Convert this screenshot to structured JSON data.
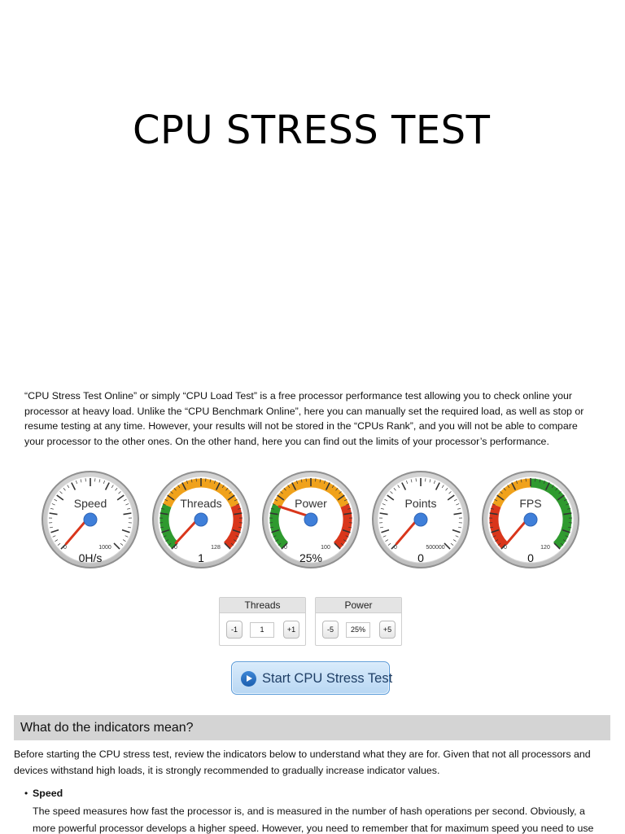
{
  "title": "CPU STRESS TEST",
  "intro": "“CPU Stress Test Online” or simply “CPU Load Test” is a free processor performance test allowing you to check online your processor at heavy load. Unlike the “CPU Benchmark Online”, here you can manually set the required load, as well as stop or resume testing at any time. However, your results will not be stored in the “CPUs Rank”, and you will not be able to compare your processor to the other ones. On the other hand, here you can find out the limits of your processor’s performance.",
  "gauges": [
    {
      "label": "Speed",
      "min": "0",
      "max": "1000",
      "value_text": "0H/s",
      "value": 0,
      "range_max": 1000,
      "bands": []
    },
    {
      "label": "Threads",
      "min": "0",
      "max": "128",
      "value_text": "1",
      "value": 1,
      "range_max": 128,
      "bands": [
        {
          "from": 0.0,
          "to": 0.25,
          "color": "#2f9a2f"
        },
        {
          "from": 0.25,
          "to": 0.75,
          "color": "#f0a21b"
        },
        {
          "from": 0.75,
          "to": 1.0,
          "color": "#d9361b"
        }
      ]
    },
    {
      "label": "Power",
      "min": "0",
      "max": "100",
      "value_text": "25%",
      "value": 25,
      "range_max": 100,
      "bands": [
        {
          "from": 0.0,
          "to": 0.25,
          "color": "#2f9a2f"
        },
        {
          "from": 0.25,
          "to": 0.75,
          "color": "#f0a21b"
        },
        {
          "from": 0.75,
          "to": 1.0,
          "color": "#d9361b"
        }
      ]
    },
    {
      "label": "Points",
      "min": "0",
      "max": "500000",
      "value_text": "0",
      "value": 0,
      "range_max": 500000,
      "bands": []
    },
    {
      "label": "FPS",
      "min": "0",
      "max": "120",
      "value_text": "0",
      "value": 0,
      "range_max": 120,
      "bands": [
        {
          "from": 0.0,
          "to": 0.25,
          "color": "#d9361b"
        },
        {
          "from": 0.25,
          "to": 0.5,
          "color": "#f0a21b"
        },
        {
          "from": 0.5,
          "to": 1.0,
          "color": "#2f9a2f"
        }
      ]
    }
  ],
  "threads_control": {
    "header": "Threads",
    "minus": "-1",
    "value": "1",
    "plus": "+1"
  },
  "power_control": {
    "header": "Power",
    "minus": "-5",
    "value": "25%",
    "plus": "+5"
  },
  "start_button": {
    "label": "Start CPU Stress Test",
    "icon": "play-icon"
  },
  "section": {
    "heading": "What do the indicators mean?",
    "paragraph": "Before starting the CPU stress test, review the indicators below to understand what they are for. Given that not all processors and devices withstand high loads, it is strongly recommended to gradually increase indicator values.",
    "bullet_term": "Speed",
    "bullet_text": "The speed measures how fast the processor is, and is measured in the number of hash operations per second. Obviously, a more powerful processor develops a higher speed. However, you need to remember that for maximum speed you need to use the full"
  },
  "colors": {
    "green": "#2f9a2f",
    "orange": "#f0a21b",
    "red": "#d9361b",
    "needle": "#d9361b",
    "hub": "#3f7fd9"
  }
}
